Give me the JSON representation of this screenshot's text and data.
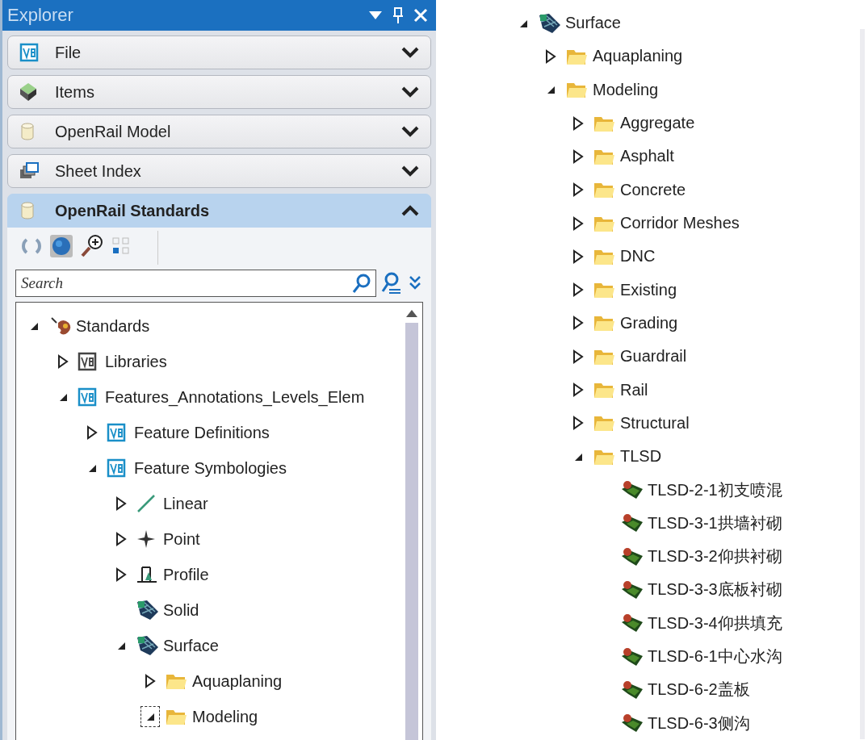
{
  "explorer": {
    "title": "Explorer",
    "sections": [
      {
        "label": "File",
        "kind": "v8",
        "expanded": false
      },
      {
        "label": "Items",
        "kind": "cube",
        "expanded": false
      },
      {
        "label": "OpenRail Model",
        "kind": "cylinder",
        "expanded": false
      },
      {
        "label": "Sheet Index",
        "kind": "sheets",
        "expanded": false
      },
      {
        "label": "OpenRail Standards",
        "kind": "cylinder",
        "expanded": true
      }
    ],
    "toolbar": [
      {
        "kind": "refresh"
      },
      {
        "kind": "globe"
      },
      {
        "kind": "zoom"
      },
      {
        "kind": "grid"
      }
    ],
    "search": {
      "placeholder": "Search"
    },
    "tree": [
      {
        "label": "Standards",
        "kind": "palette",
        "expandable": true,
        "expanded": true,
        "focused": false,
        "children": [
          {
            "label": "Libraries",
            "kind": "v8dark",
            "expandable": true,
            "expanded": false,
            "focused": false
          },
          {
            "label": "Features_Annotations_Levels_Elem",
            "kind": "v8",
            "expandable": true,
            "expanded": true,
            "focused": false,
            "children": [
              {
                "label": "Feature Definitions",
                "kind": "v8",
                "expandable": true,
                "expanded": false,
                "focused": false
              },
              {
                "label": "Feature Symbologies",
                "kind": "v8",
                "expandable": true,
                "expanded": true,
                "focused": false,
                "children": [
                  {
                    "label": "Linear",
                    "kind": "line",
                    "expandable": true,
                    "expanded": false,
                    "focused": false
                  },
                  {
                    "label": "Point",
                    "kind": "point",
                    "expandable": true,
                    "expanded": false,
                    "focused": false
                  },
                  {
                    "label": "Profile",
                    "kind": "profile",
                    "expandable": true,
                    "expanded": false,
                    "focused": false
                  },
                  {
                    "label": "Solid",
                    "kind": "mesh",
                    "expandable": false,
                    "focused": false
                  },
                  {
                    "label": "Surface",
                    "kind": "mesh",
                    "expandable": true,
                    "expanded": true,
                    "focused": false,
                    "children": [
                      {
                        "label": "Aquaplaning",
                        "kind": "folder",
                        "expandable": true,
                        "expanded": false,
                        "focused": false
                      },
                      {
                        "label": "Modeling",
                        "kind": "folder",
                        "expandable": true,
                        "expanded": true,
                        "focused": true
                      }
                    ]
                  }
                ]
              }
            ]
          }
        ]
      }
    ]
  },
  "detail_tree": [
    {
      "label": "Surface",
      "kind": "mesh",
      "expandable": true,
      "expanded": true,
      "children": [
        {
          "label": "Aquaplaning",
          "kind": "folder",
          "expandable": true,
          "expanded": false
        },
        {
          "label": "Modeling",
          "kind": "folder",
          "expandable": true,
          "expanded": true,
          "children": [
            {
              "label": "Aggregate",
              "kind": "folder",
              "expandable": true,
              "expanded": false
            },
            {
              "label": "Asphalt",
              "kind": "folder",
              "expandable": true,
              "expanded": false
            },
            {
              "label": "Concrete",
              "kind": "folder",
              "expandable": true,
              "expanded": false
            },
            {
              "label": "Corridor Meshes",
              "kind": "folder",
              "expandable": true,
              "expanded": false
            },
            {
              "label": "DNC",
              "kind": "folder",
              "expandable": true,
              "expanded": false
            },
            {
              "label": "Existing",
              "kind": "folder",
              "expandable": true,
              "expanded": false
            },
            {
              "label": "Grading",
              "kind": "folder",
              "expandable": true,
              "expanded": false
            },
            {
              "label": "Guardrail",
              "kind": "folder",
              "expandable": true,
              "expanded": false
            },
            {
              "label": "Rail",
              "kind": "folder",
              "expandable": true,
              "expanded": false
            },
            {
              "label": "Structural",
              "kind": "folder",
              "expandable": true,
              "expanded": false
            },
            {
              "label": "TLSD",
              "kind": "folder",
              "expandable": true,
              "expanded": true,
              "children": [
                {
                  "label": "TLSD-2-1初支喷混",
                  "kind": "symbol",
                  "expandable": false
                },
                {
                  "label": "TLSD-3-1拱墙衬砌",
                  "kind": "symbol",
                  "expandable": false
                },
                {
                  "label": "TLSD-3-2仰拱衬砌",
                  "kind": "symbol",
                  "expandable": false
                },
                {
                  "label": "TLSD-3-3底板衬砌",
                  "kind": "symbol",
                  "expandable": false
                },
                {
                  "label": "TLSD-3-4仰拱填充",
                  "kind": "symbol",
                  "expandable": false
                },
                {
                  "label": "TLSD-6-1中心水沟",
                  "kind": "symbol",
                  "expandable": false
                },
                {
                  "label": "TLSD-6-2盖板",
                  "kind": "symbol",
                  "expandable": false
                },
                {
                  "label": "TLSD-6-3侧沟",
                  "kind": "symbol",
                  "expandable": false
                }
              ]
            }
          ]
        }
      ]
    }
  ]
}
